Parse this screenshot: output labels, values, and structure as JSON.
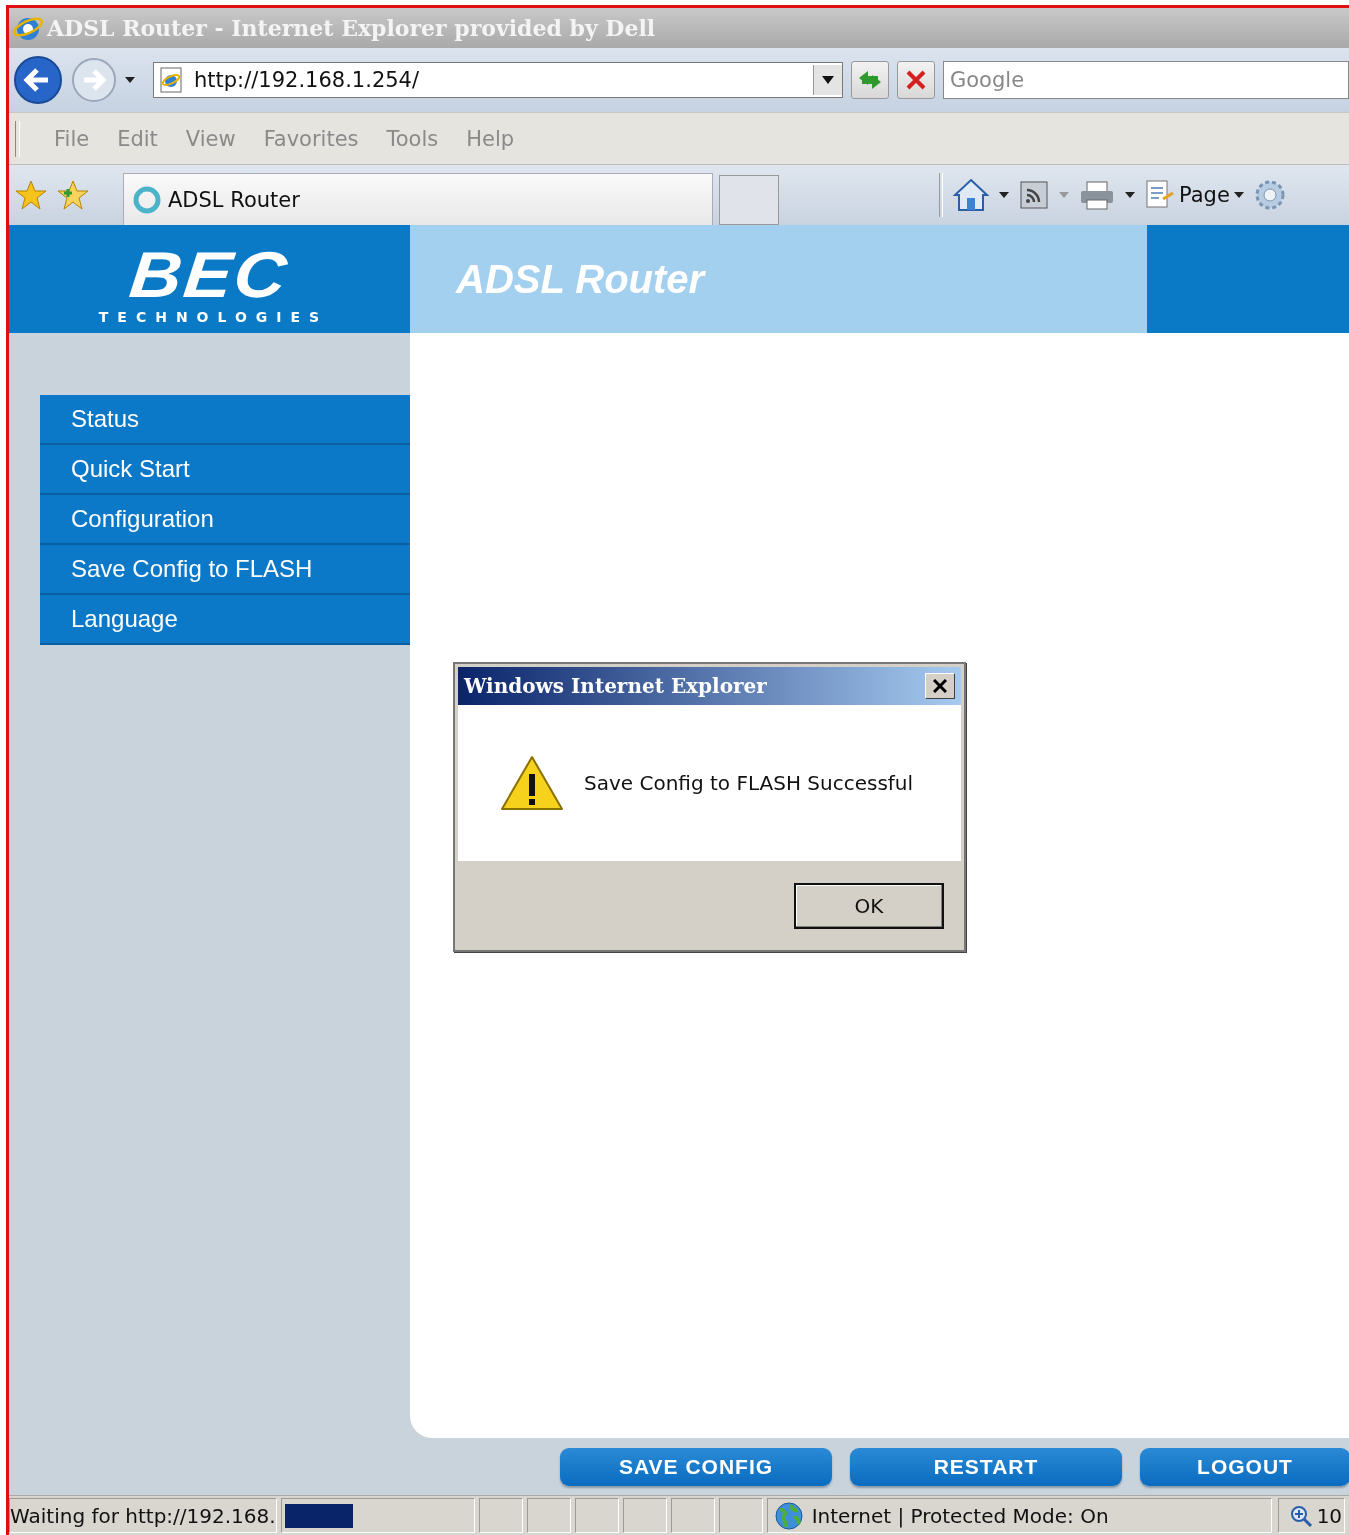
{
  "window": {
    "title": "ADSL Router - Internet Explorer provided by Dell"
  },
  "address_bar": {
    "url": "http://192.168.1.254/"
  },
  "search": {
    "placeholder": "Google"
  },
  "menu": [
    "File",
    "Edit",
    "View",
    "Favorites",
    "Tools",
    "Help"
  ],
  "tabs": [
    {
      "label": "ADSL Router",
      "selected": true
    }
  ],
  "command_bar": {
    "page_label": "Page"
  },
  "router": {
    "logo": "BEC",
    "logo_subtitle": "TECHNOLOGIES",
    "header_title": "ADSL Router",
    "nav": [
      {
        "label": "Status"
      },
      {
        "label": "Quick Start"
      },
      {
        "label": "Configuration"
      },
      {
        "label": "Save Config to FLASH"
      },
      {
        "label": "Language"
      }
    ],
    "buttons": [
      "SAVE CONFIG",
      "RESTART",
      "LOGOUT"
    ]
  },
  "dialog": {
    "title": "Windows Internet Explorer",
    "message": "Save Config to FLASH Successful",
    "buttons": [
      "OK"
    ]
  },
  "status_bar": {
    "text": "Waiting for http://192.168.",
    "progress": {
      "level": 0.37
    },
    "zone": "Internet | Protected Mode: On",
    "zoom": "10"
  }
}
